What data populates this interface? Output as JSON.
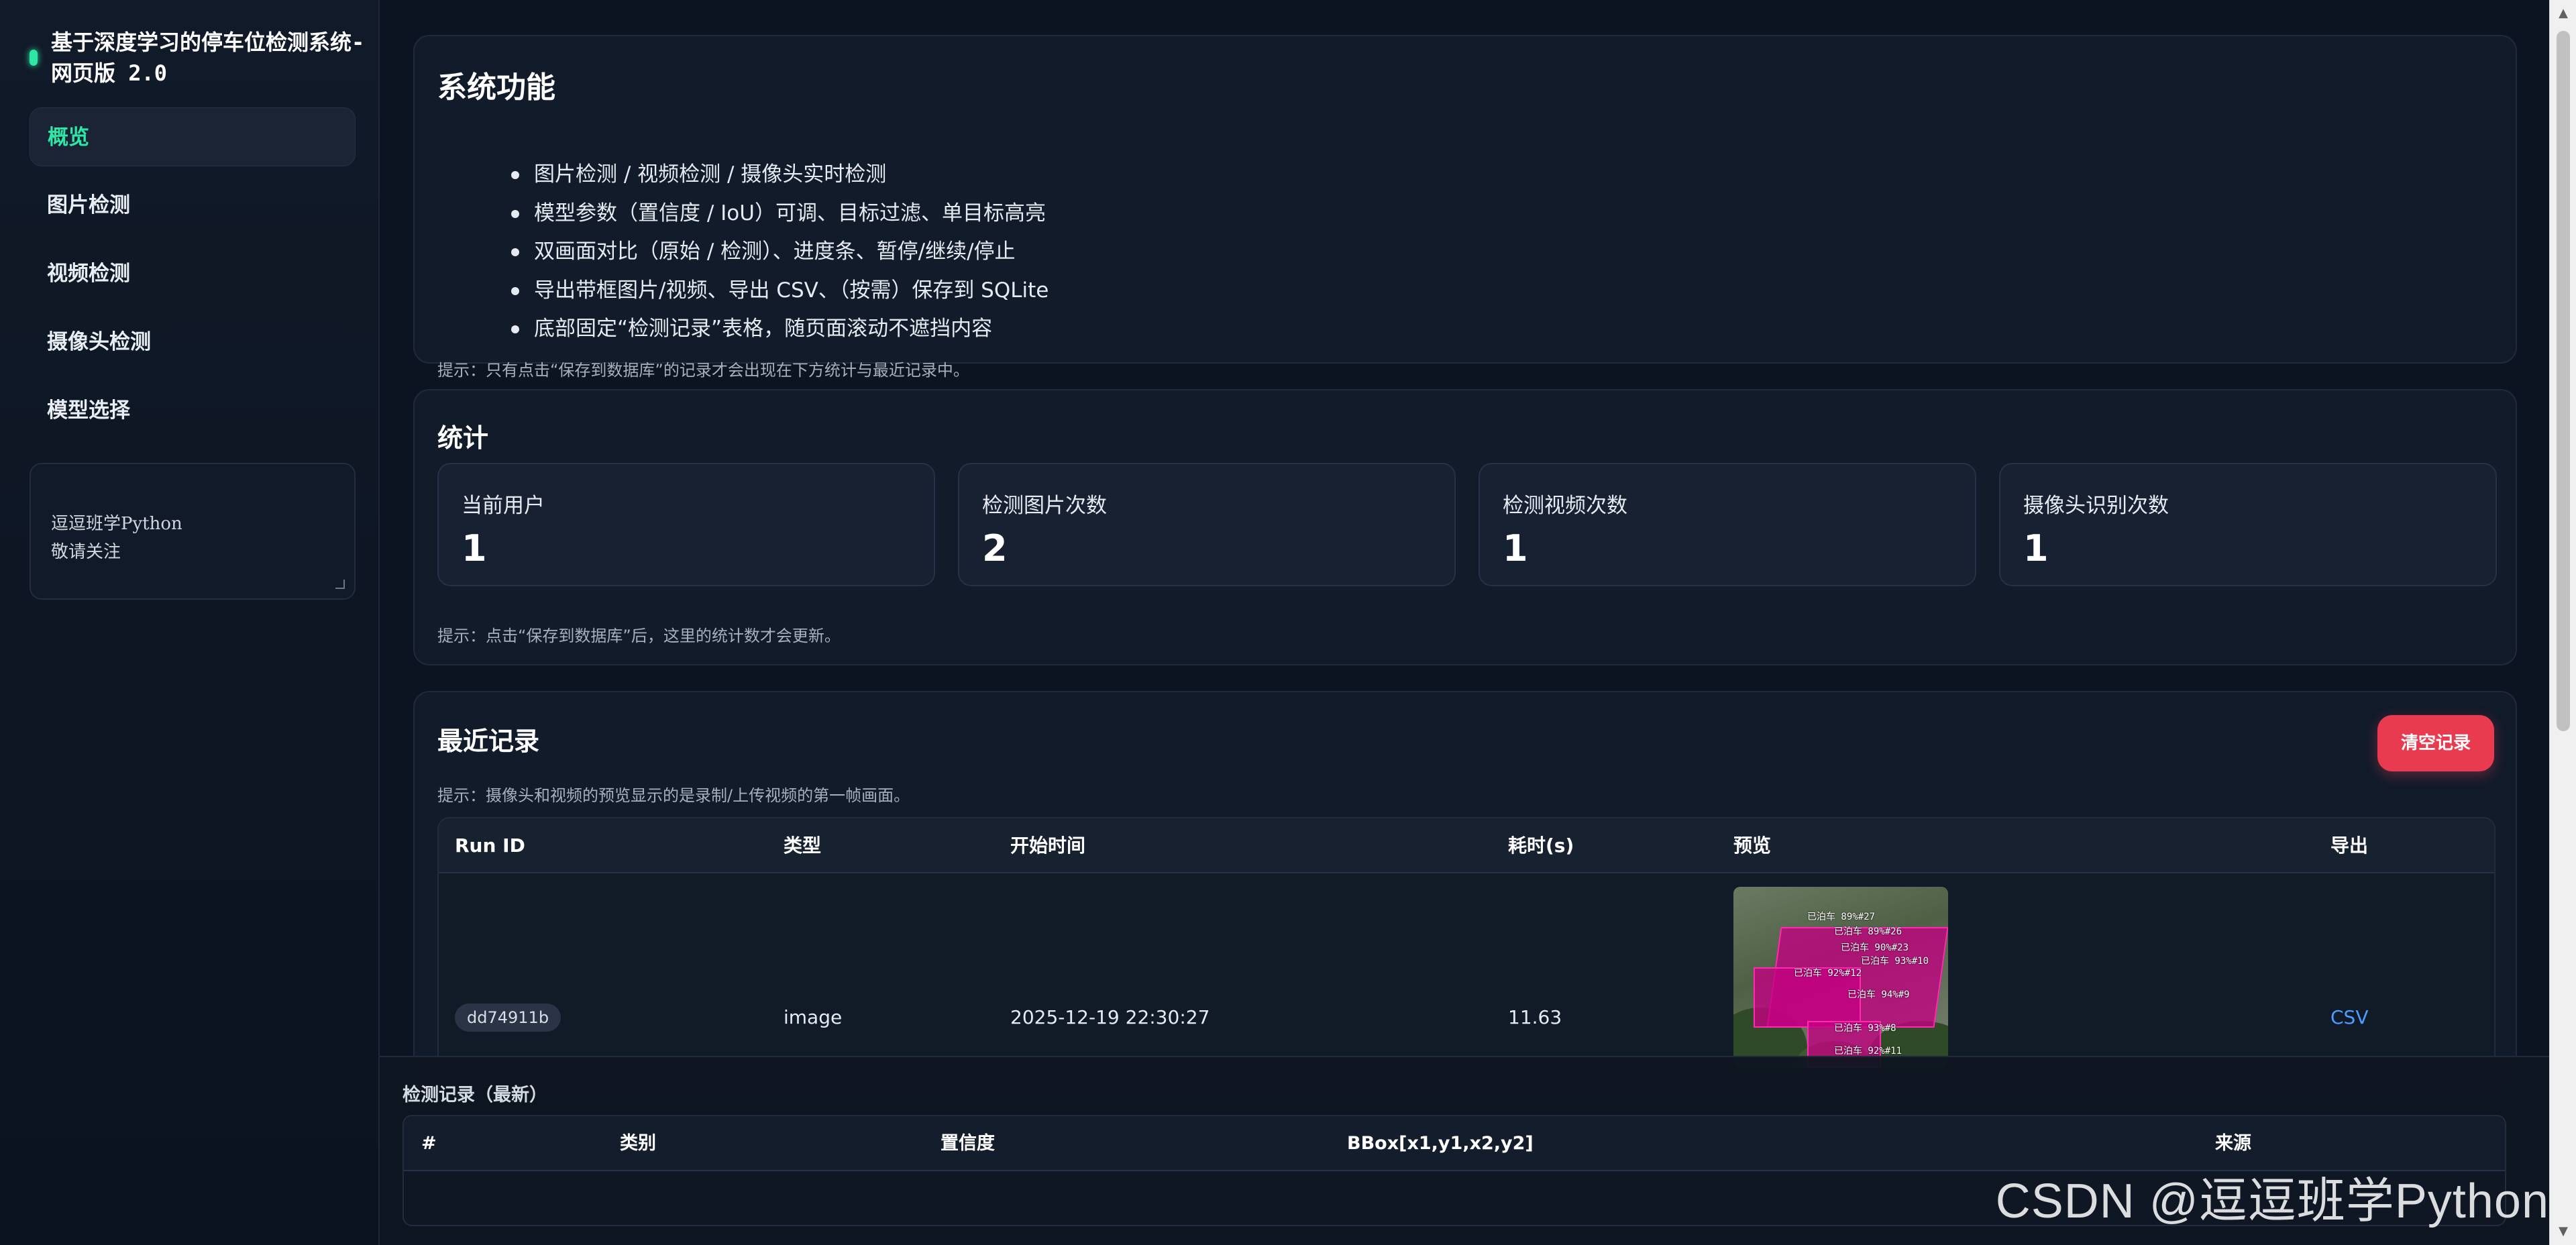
{
  "app": {
    "title": "基于深度学习的停车位检测系统-网页版 2.0",
    "accent_color": "#2ee6a6",
    "danger_color": "#e83b4f",
    "link_color": "#4a9eff"
  },
  "sidebar": {
    "items": [
      {
        "label": "概览",
        "active": true
      },
      {
        "label": "图片检测",
        "active": false
      },
      {
        "label": "视频检测",
        "active": false
      },
      {
        "label": "摄像头检测",
        "active": false
      },
      {
        "label": "模型选择",
        "active": false
      }
    ],
    "note": "逗逗班学Python\n敬请关注"
  },
  "features": {
    "title": "系统功能",
    "items": [
      "图片检测 / 视频检测 / 摄像头实时检测",
      "模型参数（置信度 / IoU）可调、目标过滤、单目标高亮",
      "双画面对比（原始 / 检测）、进度条、暂停/继续/停止",
      "导出带框图片/视频、导出 CSV、（按需）保存到 SQLite",
      "底部固定“检测记录”表格，随页面滚动不遮挡内容"
    ],
    "hint": "提示：只有点击“保存到数据库”的记录才会出现在下方统计与最近记录中。"
  },
  "stats": {
    "title": "统计",
    "cards": [
      {
        "label": "当前用户",
        "value": "1"
      },
      {
        "label": "检测图片次数",
        "value": "2"
      },
      {
        "label": "检测视频次数",
        "value": "1"
      },
      {
        "label": "摄像头识别次数",
        "value": "1"
      }
    ],
    "hint": "提示：点击“保存到数据库”后，这里的统计数才会更新。"
  },
  "recent": {
    "title": "最近记录",
    "clear_label": "清空记录",
    "hint": "提示：摄像头和视频的预览显示的是录制/上传视频的第一帧画面。",
    "columns": [
      "Run ID",
      "类型",
      "开始时间",
      "耗时(s)",
      "预览",
      "导出"
    ],
    "rows": [
      {
        "run_id": "dd74911b",
        "type": "image",
        "start_time": "2025-12-19 22:30:27",
        "duration": "11.63",
        "preview_labels": [
          "已泊车 89%#27",
          "已泊车 89%#26",
          "已泊车 90%#23",
          "已泊车 92%#12",
          "已泊车 94%#9",
          "已泊车 93%#10",
          "已泊车 93%#8",
          "已泊车 92%#11"
        ],
        "export": "CSV"
      }
    ]
  },
  "detections": {
    "title": "检测记录（最新）",
    "columns": [
      "#",
      "类别",
      "置信度",
      "BBox[x1,y1,x2,y2]",
      "来源"
    ]
  },
  "watermark": "CSDN @逗逗班学Python"
}
